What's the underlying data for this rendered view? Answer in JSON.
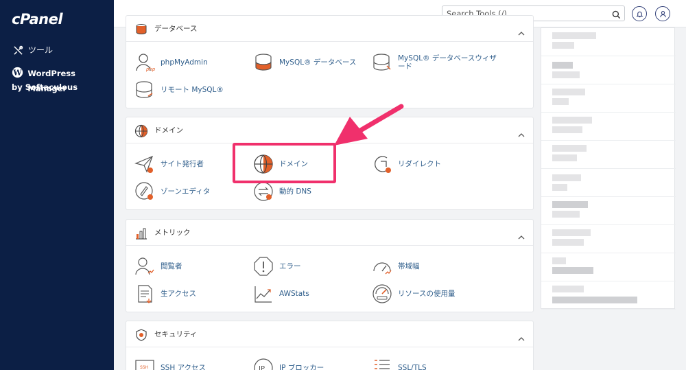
{
  "sidebar": {
    "logo": "cPanel",
    "tools_label": "ツール",
    "wp_label": "WordPress Manager",
    "wp_sub": "by Softaculous"
  },
  "topbar": {
    "search_placeholder": "Search Tools (/)"
  },
  "database": {
    "title": "データベース",
    "items": [
      "phpMyAdmin",
      "MySQL® データベース",
      "MySQL® データベースウィザード",
      "リモート MySQL®"
    ]
  },
  "domains": {
    "title": "ドメイン",
    "items": [
      "サイト発行者",
      "ドメイン",
      "リダイレクト",
      "ゾーンエディタ",
      "動的 DNS"
    ]
  },
  "metrics": {
    "title": "メトリック",
    "items": [
      "閲覧者",
      "エラー",
      "帯域幅",
      "生アクセス",
      "AWStats",
      "リソースの使用量"
    ]
  },
  "security": {
    "title": "セキュリティ",
    "items": [
      "SSH アクセス",
      "IP ブロッカー",
      "SSL/TLS"
    ]
  },
  "colors": {
    "sidebar": "#0c1f45",
    "highlight": "#f0306c",
    "link": "#2d5c8a",
    "accent": "#e2602a"
  }
}
